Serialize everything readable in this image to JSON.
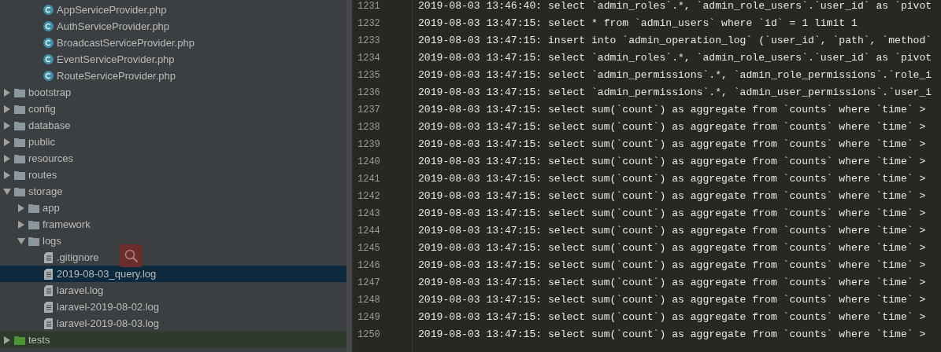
{
  "project_tree": {
    "partial_items": [
      {
        "label": "AppServiceProvider.php",
        "kind": "class",
        "selected": false
      },
      {
        "label": "AuthServiceProvider.php",
        "kind": "class",
        "selected": false
      },
      {
        "label": "BroadcastServiceProvider.php",
        "kind": "class",
        "selected": false
      },
      {
        "label": "EventServiceProvider.php",
        "kind": "class",
        "selected": false
      },
      {
        "label": "RouteServiceProvider.php",
        "kind": "class",
        "selected": false
      }
    ],
    "items": [
      {
        "label": "bootstrap",
        "kind": "folder",
        "expanded": false,
        "selected": false
      },
      {
        "label": "config",
        "kind": "folder",
        "expanded": false,
        "selected": false
      },
      {
        "label": "database",
        "kind": "folder",
        "expanded": false,
        "selected": false
      },
      {
        "label": "public",
        "kind": "folder",
        "expanded": false,
        "selected": false
      },
      {
        "label": "resources",
        "kind": "folder",
        "expanded": false,
        "selected": false
      },
      {
        "label": "routes",
        "kind": "folder",
        "expanded": false,
        "selected": false
      },
      {
        "label": "storage",
        "kind": "folder",
        "expanded": true,
        "selected": false,
        "children": [
          {
            "label": "app",
            "kind": "folder",
            "expanded": false,
            "selected": false
          },
          {
            "label": "framework",
            "kind": "folder",
            "expanded": false,
            "selected": false
          },
          {
            "label": "logs",
            "kind": "folder",
            "expanded": true,
            "selected": false,
            "children": [
              {
                "label": ".gitignore",
                "kind": "text-file",
                "selected": false
              },
              {
                "label": "2019-08-03_query.log",
                "kind": "text-file",
                "selected": true
              },
              {
                "label": "laravel.log",
                "kind": "text-file",
                "selected": false
              },
              {
                "label": "laravel-2019-08-02.log",
                "kind": "text-file",
                "selected": false
              },
              {
                "label": "laravel-2019-08-03.log",
                "kind": "text-file",
                "selected": false
              }
            ]
          }
        ]
      },
      {
        "label": "tests",
        "kind": "test-folder",
        "expanded": false,
        "selected": false
      }
    ]
  },
  "editor": {
    "lines": [
      {
        "number": "1231",
        "text": "2019-08-03 13:46:40: select `admin_roles`.*, `admin_role_users`.`user_id` as `pivot"
      },
      {
        "number": "1232",
        "text": "2019-08-03 13:47:15: select * from `admin_users` where `id` = 1 limit 1"
      },
      {
        "number": "1233",
        "text": "2019-08-03 13:47:15: insert into `admin_operation_log` (`user_id`, `path`, `method`"
      },
      {
        "number": "1234",
        "text": "2019-08-03 13:47:15: select `admin_roles`.*, `admin_role_users`.`user_id` as `pivot"
      },
      {
        "number": "1235",
        "text": "2019-08-03 13:47:15: select `admin_permissions`.*, `admin_role_permissions`.`role_i"
      },
      {
        "number": "1236",
        "text": "2019-08-03 13:47:15: select `admin_permissions`.*, `admin_user_permissions`.`user_i"
      },
      {
        "number": "1237",
        "text": "2019-08-03 13:47:15: select sum(`count`) as aggregate from `counts` where `time` >"
      },
      {
        "number": "1238",
        "text": "2019-08-03 13:47:15: select sum(`count`) as aggregate from `counts` where `time` >"
      },
      {
        "number": "1239",
        "text": "2019-08-03 13:47:15: select sum(`count`) as aggregate from `counts` where `time` >"
      },
      {
        "number": "1240",
        "text": "2019-08-03 13:47:15: select sum(`count`) as aggregate from `counts` where `time` >"
      },
      {
        "number": "1241",
        "text": "2019-08-03 13:47:15: select sum(`count`) as aggregate from `counts` where `time` >"
      },
      {
        "number": "1242",
        "text": "2019-08-03 13:47:15: select sum(`count`) as aggregate from `counts` where `time` >"
      },
      {
        "number": "1243",
        "text": "2019-08-03 13:47:15: select sum(`count`) as aggregate from `counts` where `time` >"
      },
      {
        "number": "1244",
        "text": "2019-08-03 13:47:15: select sum(`count`) as aggregate from `counts` where `time` >"
      },
      {
        "number": "1245",
        "text": "2019-08-03 13:47:15: select sum(`count`) as aggregate from `counts` where `time` >"
      },
      {
        "number": "1246",
        "text": "2019-08-03 13:47:15: select sum(`count`) as aggregate from `counts` where `time` >"
      },
      {
        "number": "1247",
        "text": "2019-08-03 13:47:15: select sum(`count`) as aggregate from `counts` where `time` >"
      },
      {
        "number": "1248",
        "text": "2019-08-03 13:47:15: select sum(`count`) as aggregate from `counts` where `time` >"
      },
      {
        "number": "1249",
        "text": "2019-08-03 13:47:15: select sum(`count`) as aggregate from `counts` where `time` >"
      },
      {
        "number": "1250",
        "text": "2019-08-03 13:47:15: select sum(`count`) as aggregate from `counts` where `time` >"
      }
    ]
  }
}
